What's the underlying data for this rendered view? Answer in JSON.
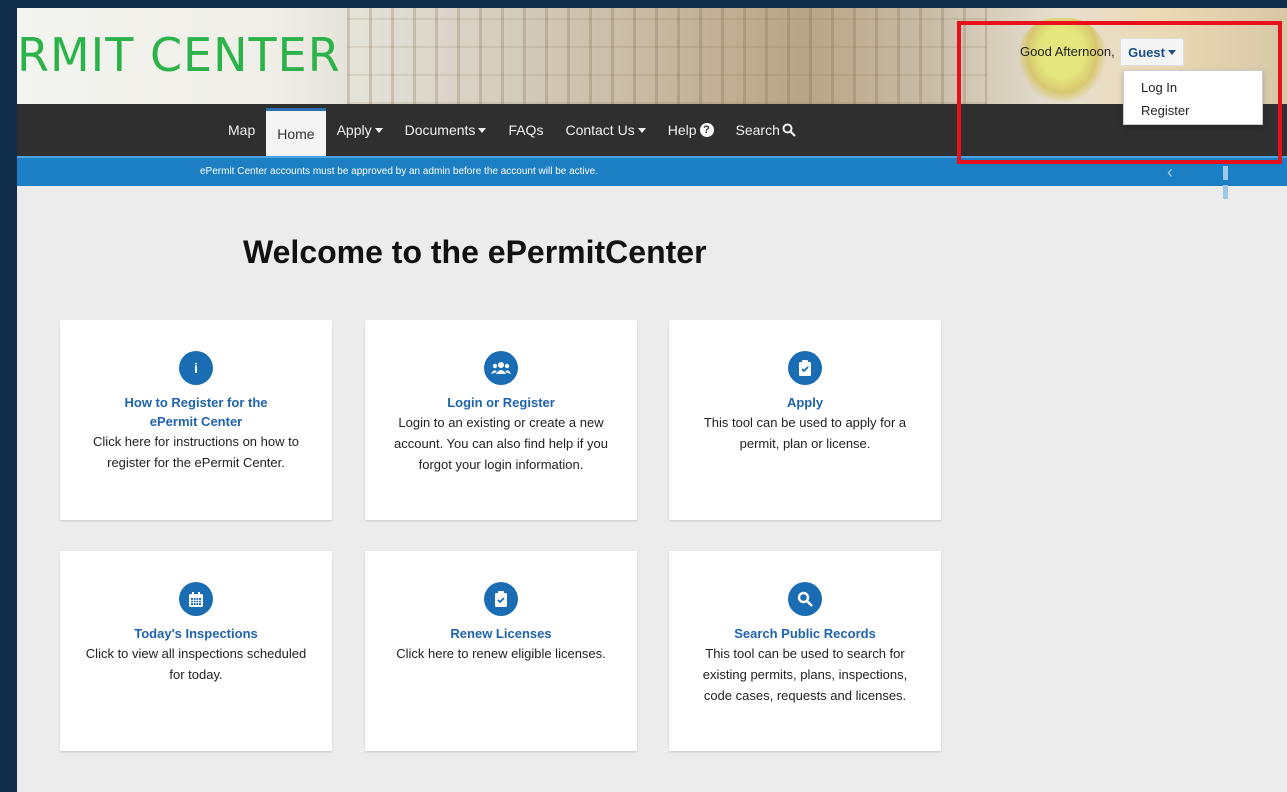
{
  "header": {
    "brand": "RMIT CENTER",
    "greeting": "Good Afternoon,",
    "user_label": "Guest"
  },
  "user_menu": {
    "items": [
      {
        "label": "Log In"
      },
      {
        "label": "Register"
      }
    ]
  },
  "nav": {
    "items": [
      {
        "label": "Map",
        "has_caret": false
      },
      {
        "label": "Home",
        "active": true
      },
      {
        "label": "Apply",
        "has_caret": true
      },
      {
        "label": "Documents",
        "has_caret": true
      },
      {
        "label": "FAQs"
      },
      {
        "label": "Contact Us",
        "has_caret": true
      },
      {
        "label": "Help",
        "icon": "question-circle-icon"
      },
      {
        "label": "Search",
        "icon": "search-icon"
      }
    ]
  },
  "alert": {
    "text": "ePermit Center accounts must be approved by an admin before the account will be active."
  },
  "main": {
    "heading": "Welcome to the ePermitCenter",
    "cards": [
      {
        "icon": "info-icon",
        "title": "How to Register for the ePermit Center",
        "desc": "Click here for instructions on how to register for the ePermit Center."
      },
      {
        "icon": "users-icon",
        "title": "Login or Register",
        "desc": "Login to an existing or create a new account. You can also find help if you forgot your login information."
      },
      {
        "icon": "clipboard-check-icon",
        "title": "Apply",
        "desc": "This tool can be used to apply for a permit, plan or license."
      },
      {
        "icon": "calendar-icon",
        "title": "Today's Inspections",
        "desc": "Click to view all inspections scheduled for today."
      },
      {
        "icon": "clipboard-check-icon",
        "title": "Renew Licenses",
        "desc": "Click here to renew eligible licenses."
      },
      {
        "icon": "search-icon",
        "title": "Search Public Records",
        "desc": "This tool can be used to search for existing permits, plans, inspections, code cases, requests and licenses."
      }
    ]
  },
  "colors": {
    "brand_green": "#2bb34a",
    "nav_bg": "#2f2f2f",
    "alert_bg": "#1c7fc4",
    "accent_blue": "#1a6cb3",
    "highlight_red": "#e8101a"
  }
}
